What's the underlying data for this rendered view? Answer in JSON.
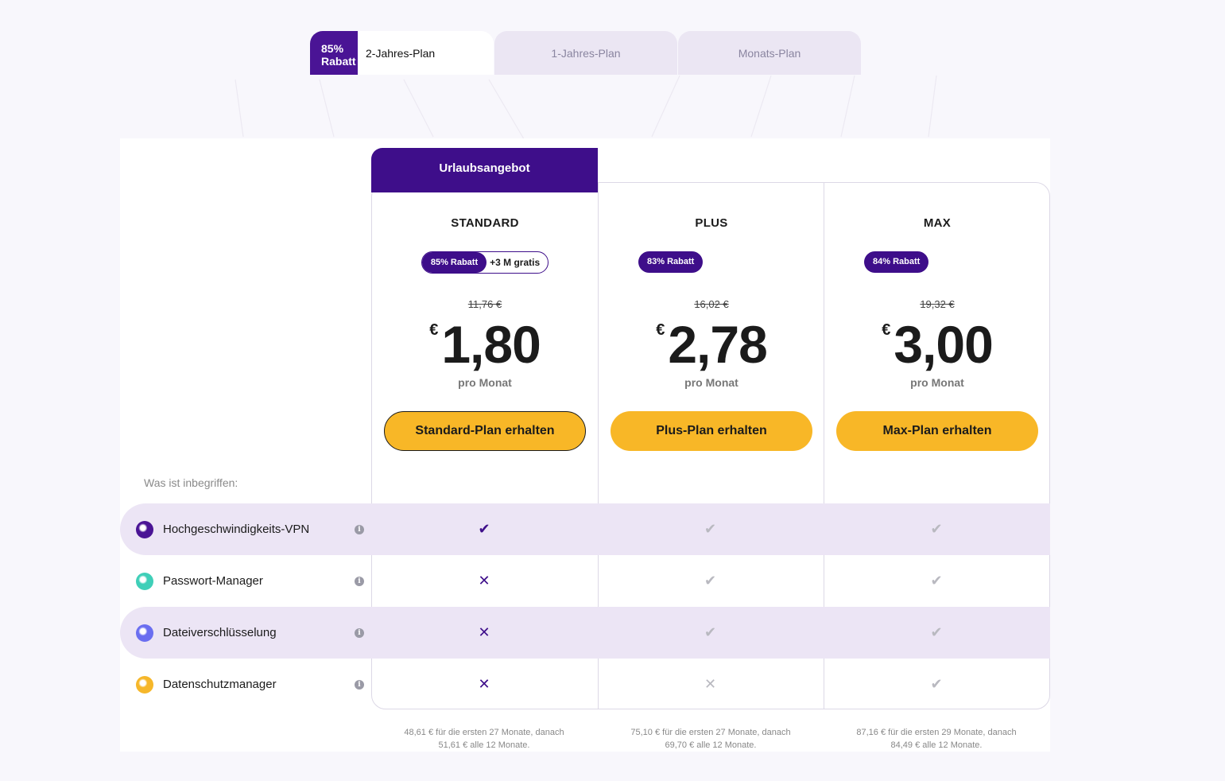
{
  "tabs": [
    {
      "badge": "85% Rabatt",
      "label": "2-Jahres-Plan",
      "active": true
    },
    {
      "label": "1-Jahres-Plan",
      "active": false
    },
    {
      "label": "Monats-Plan",
      "active": false
    }
  ],
  "offer_banner": "Urlaubsangebot",
  "plans": [
    {
      "name": "STANDARD",
      "discount": "85% Rabatt",
      "extra": "+3 M gratis",
      "old_price": "11,76 €",
      "currency": "€",
      "price": "1,80",
      "per": "pro Monat",
      "cta": "Standard-Plan erhalten",
      "footnote_1": "48,61 € für die ersten 27 Monate, danach",
      "footnote_2": "51,61 € alle 12 Monate."
    },
    {
      "name": "PLUS",
      "discount": "83% Rabatt",
      "old_price": "16,02 €",
      "currency": "€",
      "price": "2,78",
      "per": "pro Monat",
      "cta": "Plus-Plan erhalten",
      "footnote_1": "75,10 € für die ersten 27 Monate, danach",
      "footnote_2": "69,70 € alle 12 Monate."
    },
    {
      "name": "MAX",
      "discount": "84% Rabatt",
      "old_price": "19,32 €",
      "currency": "€",
      "price": "3,00",
      "per": "pro Monat",
      "cta": "Max-Plan erhalten",
      "footnote_1": "87,16 € für die ersten 29 Monate, danach",
      "footnote_2": "84,49 € alle 12 Monate."
    }
  ],
  "included_label": "Was ist inbegriffen:",
  "features": [
    {
      "label": "Hochgeschwindigkeits-VPN",
      "icon": "vpn-shield-icon",
      "color": "#4a1495",
      "marks": [
        "yes",
        "yes-muted",
        "yes-muted"
      ]
    },
    {
      "label": "Passwort-Manager",
      "icon": "password-manager-icon",
      "color": "#3fcfb8",
      "marks": [
        "no",
        "yes-muted",
        "yes-muted"
      ]
    },
    {
      "label": "Dateiverschlüsselung",
      "icon": "file-encryption-icon",
      "color": "#6a6ef0",
      "marks": [
        "no",
        "yes-muted",
        "yes-muted"
      ]
    },
    {
      "label": "Datenschutzmanager",
      "icon": "privacy-manager-icon",
      "color": "#f6b72a",
      "marks": [
        "no",
        "no-muted",
        "yes-muted"
      ]
    }
  ],
  "symbols": {
    "check": "✔",
    "cross": "✕",
    "info": "i"
  },
  "colors": {
    "accent": "#3e0e8a",
    "cta": "#f8b727",
    "row_shade": "#ece5f5"
  }
}
